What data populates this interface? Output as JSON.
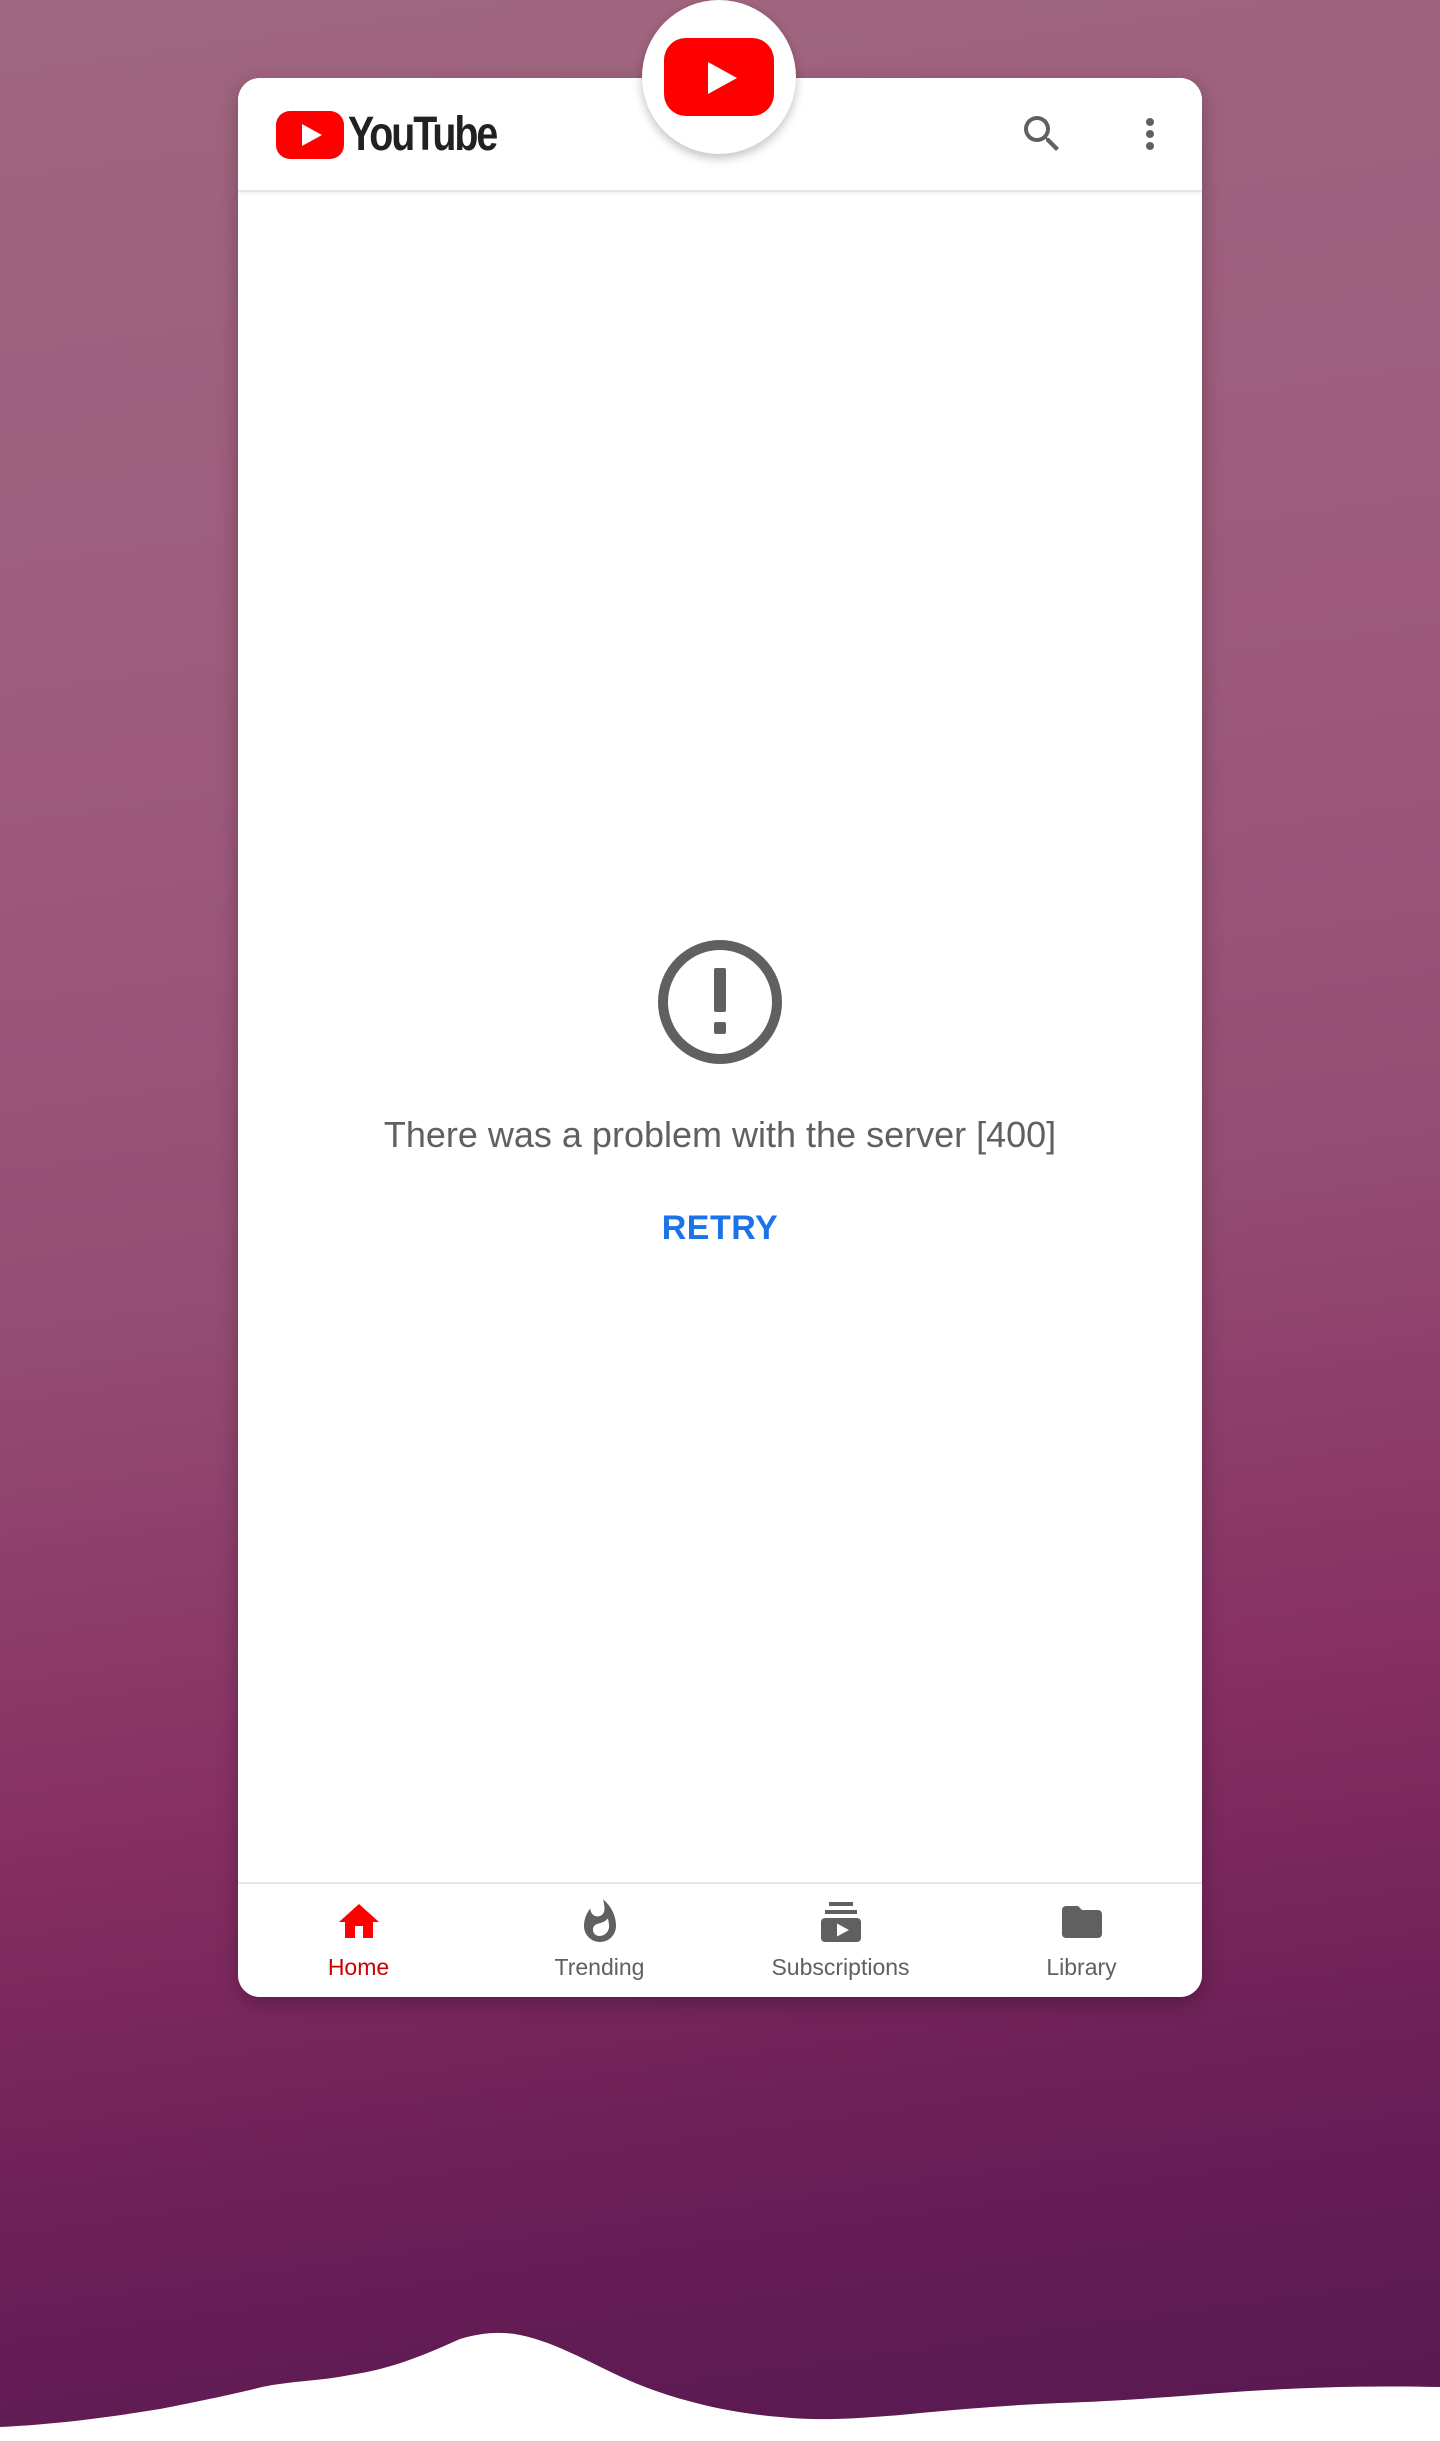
{
  "app": {
    "name": "YouTube",
    "brand_color": "#ff0000",
    "accent_color": "#1a73e8"
  },
  "header": {
    "logo_text": "YouTube",
    "icons": [
      "search-icon",
      "more-vert-icon"
    ]
  },
  "error": {
    "icon": "error-outline-icon",
    "message": "There was a problem with the server [400]",
    "retry_label": "RETRY"
  },
  "bottom_nav": {
    "active": "Home",
    "items": [
      {
        "label": "Home",
        "icon": "home-icon"
      },
      {
        "label": "Trending",
        "icon": "flame-icon"
      },
      {
        "label": "Subscriptions",
        "icon": "subscriptions-icon"
      },
      {
        "label": "Library",
        "icon": "folder-icon"
      }
    ]
  }
}
